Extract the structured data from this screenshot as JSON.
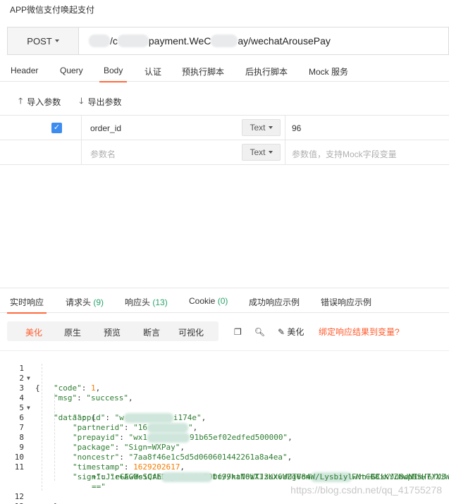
{
  "window": {
    "title": "APP微信支付唤起支付"
  },
  "request": {
    "method": "POST",
    "url_visible_a": "/c",
    "url_visible_b": "payment.WeC",
    "url_visible_c": "ay/wechatArousePay"
  },
  "request_tabs": [
    {
      "label": "Header"
    },
    {
      "label": "Query"
    },
    {
      "label": "Body"
    },
    {
      "label": "认证"
    },
    {
      "label": "预执行脚本"
    },
    {
      "label": "后执行脚本"
    },
    {
      "label": "Mock 服务"
    }
  ],
  "body_tools": {
    "import": "导入参数",
    "export": "导出参数"
  },
  "params": [
    {
      "checked": true,
      "key": "order_id",
      "type": "Text",
      "value": "96"
    },
    {
      "key_placeholder": "参数名",
      "type": "Text",
      "value_placeholder": "参数值，支持Mock字段变量"
    }
  ],
  "response_tabs": [
    {
      "label": "实时响应"
    },
    {
      "label": "请求头",
      "count": "(9)"
    },
    {
      "label": "响应头",
      "count": "(13)"
    },
    {
      "label": "Cookie",
      "count": "(0)"
    },
    {
      "label": "成功响应示例"
    },
    {
      "label": "错误响应示例"
    }
  ],
  "view_modes": [
    "美化",
    "原生",
    "预览",
    "断言",
    "可视化"
  ],
  "tools": {
    "beautify": "美化",
    "bind_link": "绑定响应结果到变量?"
  },
  "code_lines": [
    {
      "n": "1",
      "text": "{"
    },
    {
      "n": "2",
      "key": "\"code\"",
      "num": "1",
      "tail": ","
    },
    {
      "n": "3",
      "key": "\"msg\"",
      "str": "\"success\"",
      "tail": ","
    },
    {
      "n": "4",
      "key": "\"data\"",
      "tail": " {"
    },
    {
      "n": "5",
      "key": "\"appid\"",
      "str_a": "\"w",
      "str_b": "i174e\"",
      "tail": ","
    },
    {
      "n": "6",
      "key": "\"partnerid\"",
      "str_a": "\"16",
      "str_b": "\"",
      "tail": ","
    },
    {
      "n": "7",
      "key": "\"prepayid\"",
      "str_a": "\"wx1",
      "str_b": "91b65ef02edfed500000\"",
      "tail": ","
    },
    {
      "n": "8",
      "key": "\"package\"",
      "str": "\"Sign=WXPay\"",
      "tail": ","
    },
    {
      "n": "9",
      "key": "\"noncestr\"",
      "str": "\"7aa8f46e1c5d5d060601442261a8a4ea\"",
      "tail": ","
    },
    {
      "n": "10",
      "key": "\"timestamp\"",
      "num": "1629202617",
      "tail": ","
    },
    {
      "n": "11",
      "key": "\"sign\"",
      "str_a": "\"r+AG0eSQfhDvjVfosia79Du//ktT0WTJ3uxvWUTV84",
      "str_b": "FMtCB8iKYZhwpNSH7/XiW"
    },
    {
      "n": "",
      "str_a": "+IuJieGEwWsiCAE",
      "str_b": "tf99haN6iXlzKX6UZg6omW/Lysbiylwvn+GCkvJu8dNIm/6YU3"
    },
    {
      "n": "",
      "str": "==\""
    },
    {
      "n": "12",
      "text": "}"
    },
    {
      "n": "13",
      "text": "}"
    }
  ],
  "watermark": "https://blog.csdn.net/qq_41755278"
}
